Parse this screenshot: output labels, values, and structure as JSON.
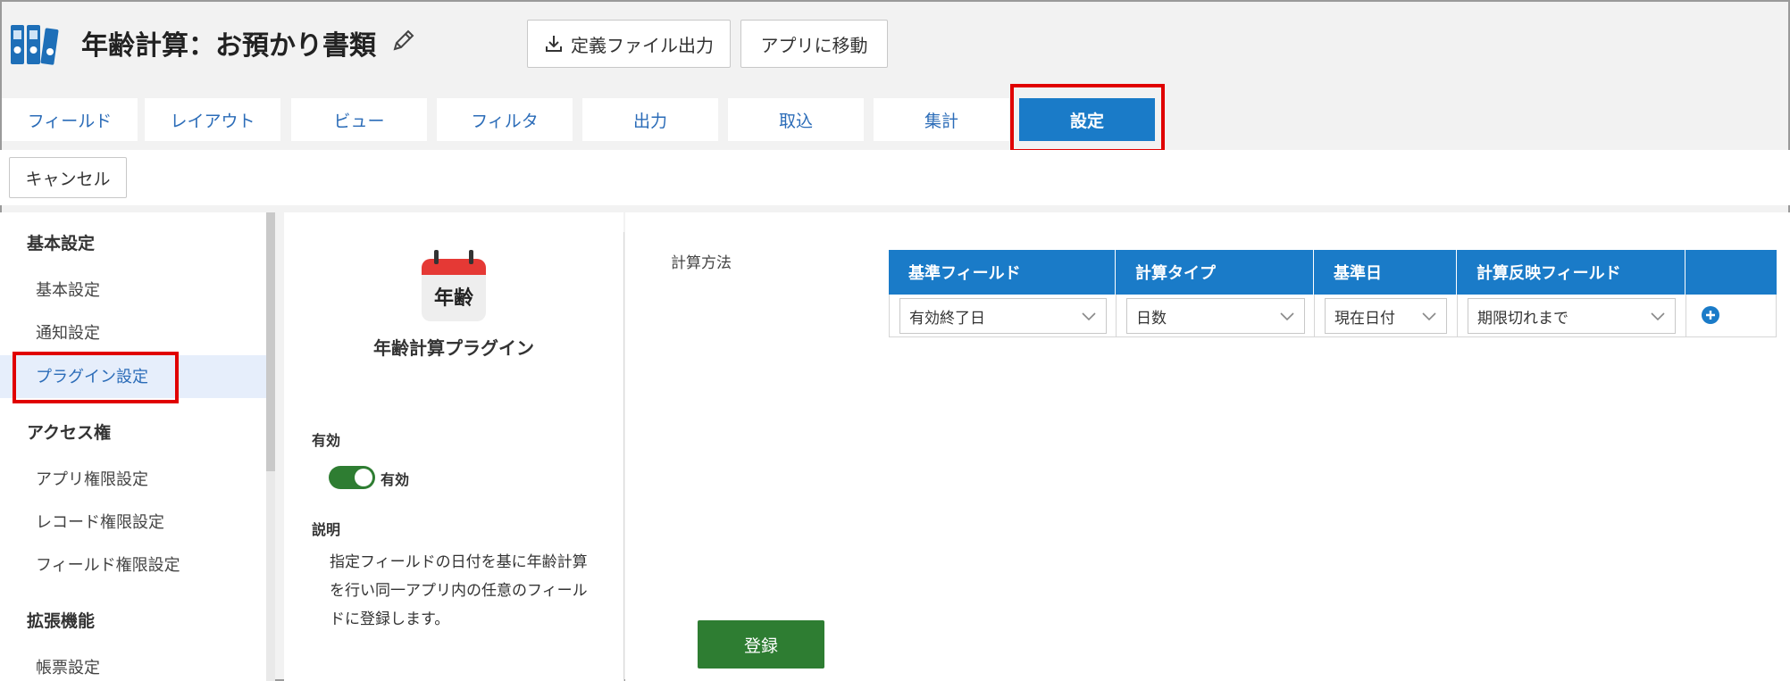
{
  "header": {
    "title": "年齢計算：お預かり書類",
    "export_label": "定義ファイル出力",
    "move_app_label": "アプリに移動"
  },
  "tabs": [
    {
      "label": "フィールド",
      "active": false
    },
    {
      "label": "レイアウト",
      "active": false
    },
    {
      "label": "ビュー",
      "active": false
    },
    {
      "label": "フィルタ",
      "active": false
    },
    {
      "label": "出力",
      "active": false
    },
    {
      "label": "取込",
      "active": false
    },
    {
      "label": "集計",
      "active": false
    },
    {
      "label": "設定",
      "active": true
    }
  ],
  "toolbar": {
    "cancel_label": "キャンセル"
  },
  "sidebar": {
    "sections": [
      {
        "heading": "基本設定",
        "items": [
          "基本設定",
          "通知設定",
          "プラグイン設定"
        ]
      },
      {
        "heading": "アクセス権",
        "items": [
          "アプリ権限設定",
          "レコード権限設定",
          "フィールド権限設定"
        ]
      },
      {
        "heading": "拡張機能",
        "items": [
          "帳票設定"
        ]
      }
    ],
    "selected": "プラグイン設定"
  },
  "plugin": {
    "icon_text": "年齢",
    "name": "年齢計算プラグイン",
    "enabled_label": "有効",
    "toggle_label": "有効",
    "enabled": true,
    "description_label": "説明",
    "description": "指定フィールドの日付を基に年齢計算を行い同一アプリ内の任意のフィールドに登録します。"
  },
  "main": {
    "calc_method_label": "計算方法",
    "columns": [
      "基準フィールド",
      "計算タイプ",
      "基準日",
      "計算反映フィールド"
    ],
    "rows": [
      [
        "有効終了日",
        "日数",
        "現在日付",
        "期限切れまで"
      ]
    ],
    "register_label": "登録"
  },
  "colors": {
    "accent": "#1a7bc8",
    "tab_text": "#2b6cb8",
    "highlight": "#e00000",
    "success": "#2e7d32",
    "calendar_red": "#e53935"
  }
}
